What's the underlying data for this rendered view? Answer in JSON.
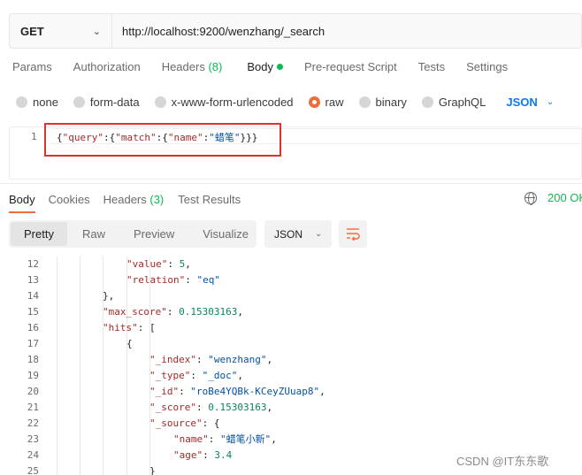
{
  "request": {
    "method": "GET",
    "url": "http://localhost:9200/wenzhang/_search"
  },
  "request_tabs": [
    {
      "label": "Params"
    },
    {
      "label": "Authorization"
    },
    {
      "label": "Headers",
      "count": "(8)"
    },
    {
      "label": "Body"
    },
    {
      "label": "Pre-request Script"
    },
    {
      "label": "Tests"
    },
    {
      "label": "Settings"
    }
  ],
  "body_types": {
    "none": "none",
    "form_data": "form-data",
    "urlencoded": "x-www-form-urlencoded",
    "raw": "raw",
    "binary": "binary",
    "graphql": "GraphQL",
    "format": "JSON"
  },
  "editor": {
    "line_number": "1",
    "p1": "{",
    "k_query": "\"query\"",
    "p2": ":{",
    "k_match": "\"match\"",
    "p3": ":{",
    "k_name": "\"name\"",
    "p4": ":",
    "v_name": "\"蜡笔\"",
    "p5": "}}}"
  },
  "response_tabs": {
    "body": "Body",
    "cookies": "Cookies",
    "headers": "Headers",
    "headers_count": "(3)",
    "tests": "Test Results"
  },
  "status": "200 OK",
  "view_tabs": {
    "pretty": "Pretty",
    "raw": "Raw",
    "preview": "Preview",
    "visualize": "Visualize",
    "format": "JSON"
  },
  "response_lines": [
    {
      "num": "12",
      "key": "\"value\"",
      "sep": ": ",
      "val": "5",
      "tail": ","
    },
    {
      "num": "13",
      "key": "\"relation\"",
      "sep": ": ",
      "val": "\"eq\"",
      "tail": ""
    },
    {
      "num": "14",
      "key": "",
      "sep": "",
      "val": "",
      "tail": "},"
    },
    {
      "num": "15",
      "key": "\"max_score\"",
      "sep": ": ",
      "val": "0.15303163",
      "tail": ","
    },
    {
      "num": "16",
      "key": "\"hits\"",
      "sep": ": ",
      "val": "",
      "tail": "["
    },
    {
      "num": "17",
      "key": "",
      "sep": "",
      "val": "",
      "tail": "{"
    },
    {
      "num": "18",
      "key": "\"_index\"",
      "sep": ": ",
      "val": "\"wenzhang\"",
      "tail": ","
    },
    {
      "num": "19",
      "key": "\"_type\"",
      "sep": ": ",
      "val": "\"_doc\"",
      "tail": ","
    },
    {
      "num": "20",
      "key": "\"_id\"",
      "sep": ": ",
      "val": "\"roBe4YQBk-KCeyZUuap8\"",
      "tail": ","
    },
    {
      "num": "21",
      "key": "\"_score\"",
      "sep": ": ",
      "val": "0.15303163",
      "tail": ","
    },
    {
      "num": "22",
      "key": "\"_source\"",
      "sep": ": ",
      "val": "",
      "tail": "{"
    },
    {
      "num": "23",
      "key": "\"name\"",
      "sep": ": ",
      "val": "\"蜡笔小新\"",
      "tail": ","
    },
    {
      "num": "24",
      "key": "\"age\"",
      "sep": ": ",
      "val": "3.4",
      "tail": ""
    },
    {
      "num": "25",
      "key": "",
      "sep": "",
      "val": "",
      "tail": "}"
    }
  ],
  "watermark": "CSDN @IT东东歌",
  "colors": {
    "accent_orange": "#f26b3a",
    "success_green": "#0cbb52",
    "link_blue": "#097bed",
    "highlight_red": "#e0302f"
  }
}
